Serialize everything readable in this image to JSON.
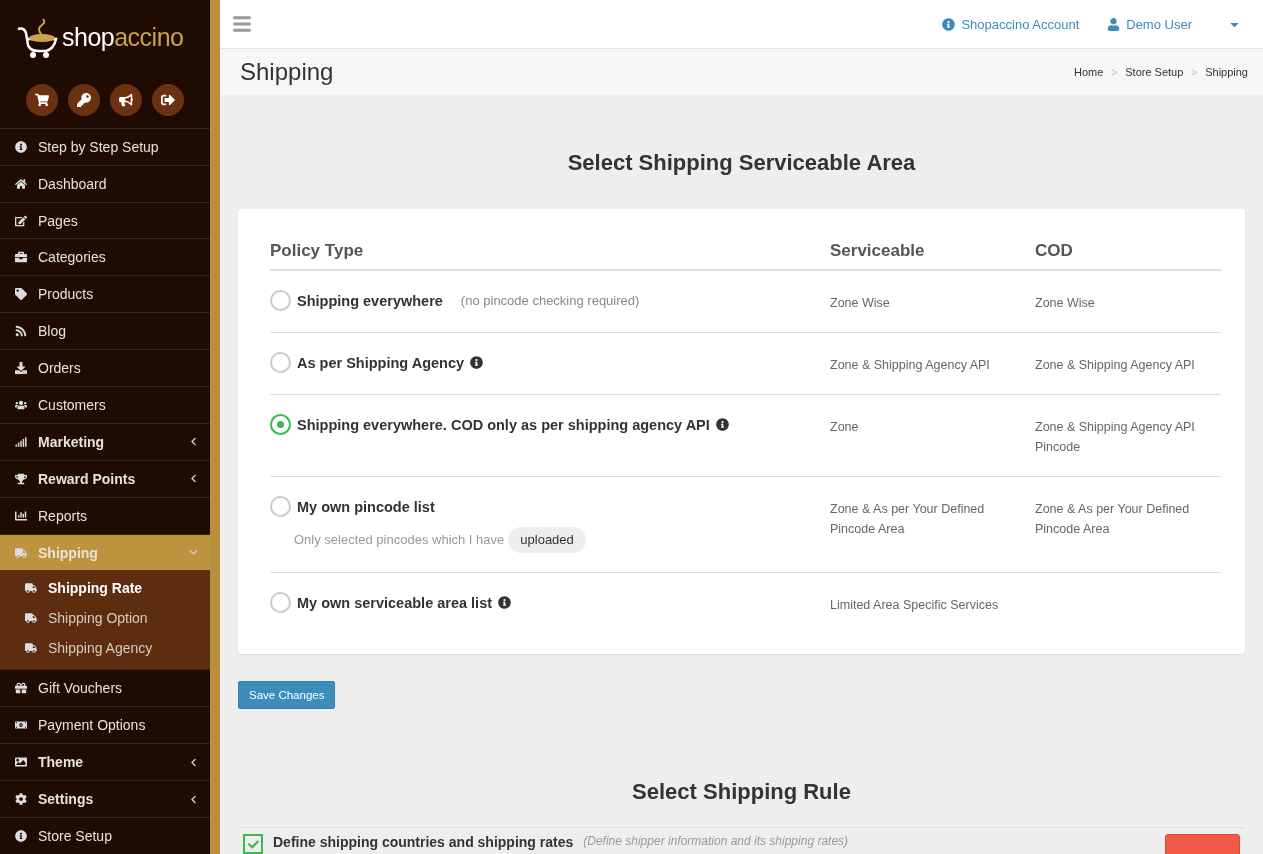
{
  "brand": {
    "name_part1": "shop",
    "name_part2": "accino"
  },
  "sidebar": {
    "items": [
      {
        "label": "Step by Step Setup",
        "selected": false,
        "has_submenu": false
      },
      {
        "label": "Dashboard",
        "selected": false,
        "has_submenu": false
      },
      {
        "label": "Pages",
        "selected": false,
        "has_submenu": false
      },
      {
        "label": "Categories",
        "selected": false,
        "has_submenu": false
      },
      {
        "label": "Products",
        "selected": false,
        "has_submenu": false
      },
      {
        "label": "Blog",
        "selected": false,
        "has_submenu": false
      },
      {
        "label": "Orders",
        "selected": false,
        "has_submenu": false
      },
      {
        "label": "Customers",
        "selected": false,
        "has_submenu": false
      },
      {
        "label": "Marketing",
        "selected": false,
        "has_submenu": true,
        "expanded": false
      },
      {
        "label": "Reward Points",
        "selected": false,
        "has_submenu": true,
        "expanded": false
      },
      {
        "label": "Reports",
        "selected": false,
        "has_submenu": false
      },
      {
        "label": "Shipping",
        "selected": true,
        "has_submenu": true,
        "expanded": true,
        "children": [
          {
            "label": "Shipping Rate",
            "selected": true
          },
          {
            "label": "Shipping Option",
            "selected": false
          },
          {
            "label": "Shipping Agency",
            "selected": false
          }
        ]
      },
      {
        "label": "Gift Vouchers",
        "selected": false,
        "has_submenu": false
      },
      {
        "label": "Payment Options",
        "selected": false,
        "has_submenu": false
      },
      {
        "label": "Theme",
        "selected": false,
        "has_submenu": true,
        "expanded": false
      },
      {
        "label": "Settings",
        "selected": false,
        "has_submenu": true,
        "expanded": false
      },
      {
        "label": "Store Setup",
        "selected": false,
        "has_submenu": false
      }
    ]
  },
  "header": {
    "account_link": "Shopaccino Account",
    "user": "Demo User"
  },
  "page": {
    "title": "Shipping",
    "breadcrumb": [
      "Home",
      "Store Setup",
      "Shipping"
    ],
    "breadcrumb_separator": ">"
  },
  "serviceable_area": {
    "title": "Select Shipping Serviceable Area",
    "columns": [
      "Policy Type",
      "Serviceable",
      "COD"
    ],
    "rows": [
      {
        "policy": "Shipping everywhere",
        "note": "(no pincode checking required)",
        "has_info": false,
        "selected": false,
        "serviceable": "Zone Wise",
        "cod": "Zone Wise"
      },
      {
        "policy": "As per Shipping Agency",
        "has_info": true,
        "selected": false,
        "serviceable": "Zone & Shipping Agency API",
        "cod": "Zone & Shipping Agency API"
      },
      {
        "policy": "Shipping everywhere. COD only as per shipping agency API",
        "has_info": true,
        "selected": true,
        "serviceable": "Zone",
        "cod": "Zone & Shipping Agency API Pincode"
      },
      {
        "policy": "My own pincode list",
        "has_info": false,
        "selected": false,
        "sub_note": "Only selected pincodes which I have",
        "sub_badge": "uploaded",
        "serviceable": "Zone & As per Your Defined Pincode Area",
        "cod": "Zone & As per Your Defined Pincode Area"
      },
      {
        "policy": "My own serviceable area list",
        "has_info": true,
        "selected": false,
        "serviceable": "Limited Area Specific Services"
      }
    ]
  },
  "save_button": "Save Changes",
  "shipping_rule": {
    "title": "Select Shipping Rule",
    "rows": [
      {
        "label": "Define shipping countries and shipping rates",
        "note": "(Define shipper information and its shipping rates)",
        "checked": true
      }
    ]
  }
}
